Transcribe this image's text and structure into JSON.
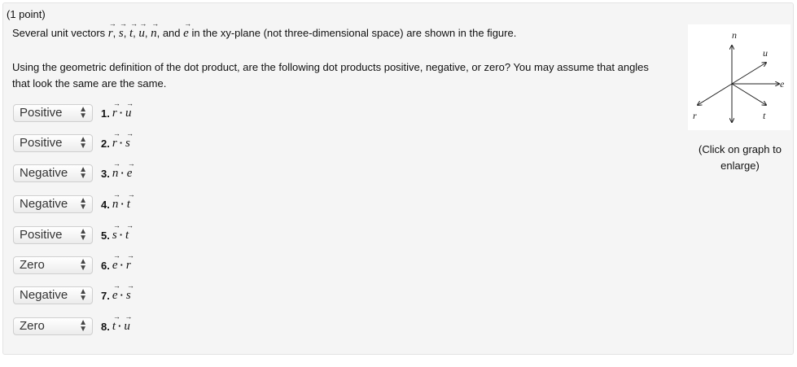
{
  "header": "(1 point)",
  "intro": {
    "prefix": "Several unit vectors ",
    "vectors": [
      "r",
      "s",
      "t",
      "u",
      "n"
    ],
    "and_text": "and",
    "last_vector": "e",
    "suffix": "in the xy-plane (not three-dimensional space) are shown in the figure."
  },
  "instructions": "Using the geometric definition of the dot product, are the following dot products positive, negative, or zero? You may assume that angles that look the same are the same.",
  "items": [
    {
      "answer": "Positive",
      "number": "1.",
      "a": "r",
      "b": "u"
    },
    {
      "answer": "Positive",
      "number": "2.",
      "a": "r",
      "b": "s"
    },
    {
      "answer": "Negative",
      "number": "3.",
      "a": "n",
      "b": "e"
    },
    {
      "answer": "Negative",
      "number": "4.",
      "a": "n",
      "b": "t"
    },
    {
      "answer": "Positive",
      "number": "5.",
      "a": "s",
      "b": "t"
    },
    {
      "answer": "Zero",
      "number": "6.",
      "a": "e",
      "b": "r"
    },
    {
      "answer": "Negative",
      "number": "7.",
      "a": "e",
      "b": "s"
    },
    {
      "answer": "Zero",
      "number": "8.",
      "a": "t",
      "b": "u"
    }
  ],
  "figure": {
    "labels": {
      "n": "n",
      "u": "u",
      "e": "e",
      "t": "t",
      "s": "s",
      "r": "r"
    }
  },
  "caption": "(Click on graph to enlarge)",
  "colors": {
    "panel": "#f5f5f5",
    "border": "#e3e3e3",
    "text": "#111111"
  }
}
